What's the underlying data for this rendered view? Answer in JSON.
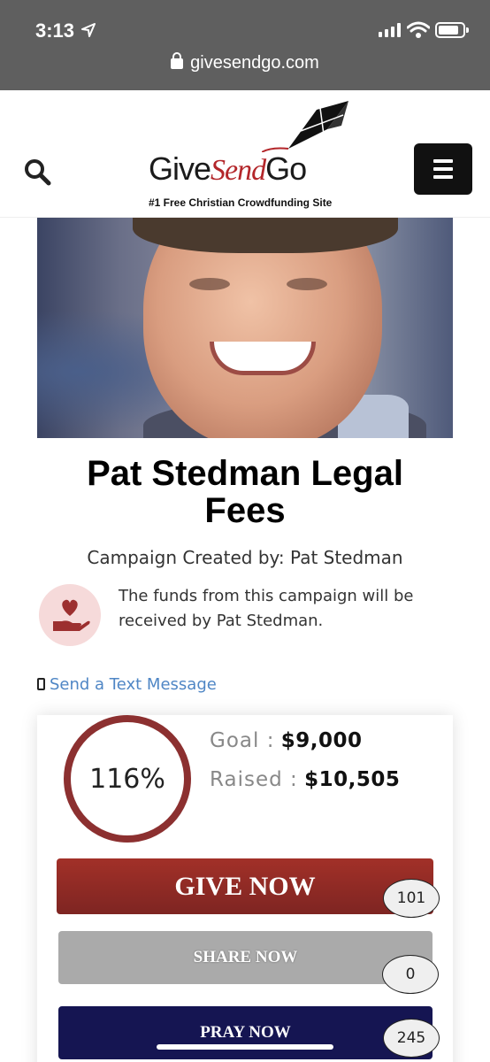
{
  "status_bar": {
    "time": "3:13",
    "url": "givesendgo.com"
  },
  "header": {
    "logo": {
      "give": "Give",
      "send": "Send",
      "go": "Go",
      "tagline": "#1 Free Christian Crowdfunding Site"
    }
  },
  "campaign": {
    "title": "Pat Stedman Legal Fees",
    "created_by": "Campaign Created by: Pat Stedman",
    "beneficiary_note": "The funds from this campaign will be received by Pat Stedman.",
    "sms_link": "Send a Text Message"
  },
  "funding": {
    "percent_label": "116%",
    "goal_label": "Goal :",
    "goal_value": "$9,000",
    "raised_label": "Raised :",
    "raised_value": "$10,505"
  },
  "actions": {
    "give": {
      "label": "GIVE NOW",
      "count": "101"
    },
    "share": {
      "label": "SHARE NOW",
      "count": "0"
    },
    "pray": {
      "label": "PRAY NOW",
      "count": "245"
    }
  },
  "colors": {
    "brand_red": "#8c3030",
    "link_blue": "#4f86c5",
    "pray_navy": "#151552"
  }
}
